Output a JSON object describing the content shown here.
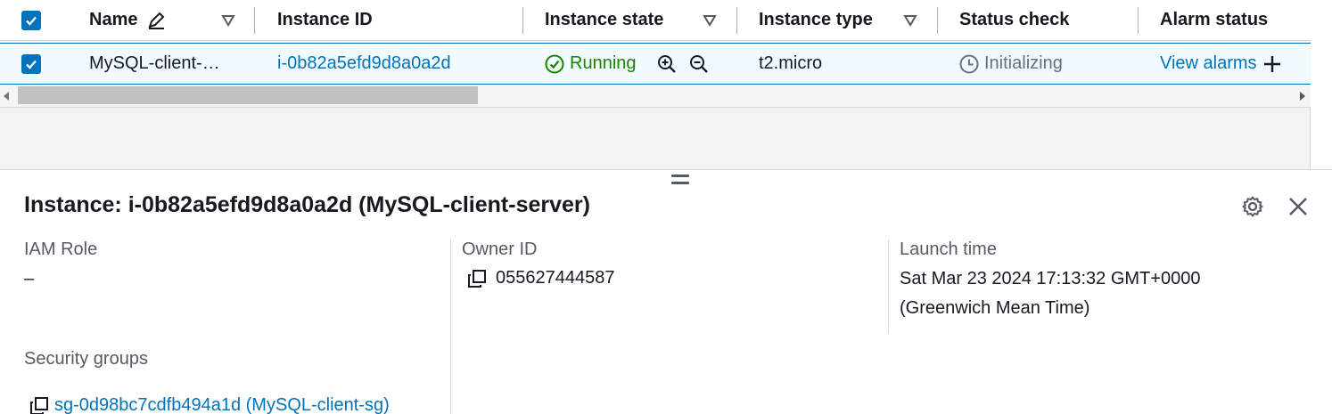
{
  "table": {
    "columns": {
      "name": "Name",
      "instance_id": "Instance ID",
      "instance_state": "Instance state",
      "instance_type": "Instance type",
      "status_check": "Status check",
      "alarm_status": "Alarm status"
    },
    "row": {
      "name": "MySQL-client-…",
      "instance_id": "i-0b82a5efd9d8a0a2d",
      "instance_state": "Running",
      "instance_type": "t2.micro",
      "status_check": "Initializing",
      "alarm_status": "View alarms"
    }
  },
  "details": {
    "title": "Instance: i-0b82a5efd9d8a0a2d (MySQL-client-server)",
    "iam_role_label": "IAM Role",
    "iam_role_value": "–",
    "owner_id_label": "Owner ID",
    "owner_id_value": "055627444587",
    "launch_time_label": "Launch time",
    "launch_time_value_line1": "Sat Mar 23 2024 17:13:32 GMT+0000",
    "launch_time_value_line2": "(Greenwich Mean Time)",
    "security_groups_label": "Security groups",
    "security_group_value": "sg-0d98bc7cdfb494a1d (MySQL-client-sg)"
  },
  "colors": {
    "accent": "#0073bb",
    "running": "#1d8102",
    "muted": "#687078"
  },
  "icons": [
    "checkbox-checked-icon",
    "edit-pencil-icon",
    "filter-triangle-icon",
    "check-circle-icon",
    "zoom-in-icon",
    "zoom-out-icon",
    "clock-icon",
    "plus-icon",
    "settings-gear-icon",
    "close-icon",
    "copy-icon",
    "drag-handle-icon"
  ]
}
